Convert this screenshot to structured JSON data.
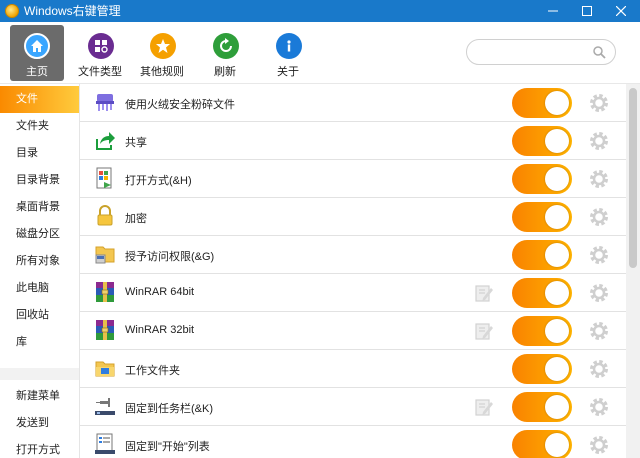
{
  "window": {
    "title": "Windows右键管理"
  },
  "toolbar": {
    "items": [
      {
        "label": "主页",
        "icon": "home-icon",
        "color": "#3aa6ff"
      },
      {
        "label": "文件类型",
        "icon": "file-types-icon",
        "color": "#6a2c91"
      },
      {
        "label": "其他规则",
        "icon": "star-icon",
        "color": "#f5a000"
      },
      {
        "label": "刷新",
        "icon": "refresh-icon",
        "color": "#2e9e3a"
      },
      {
        "label": "关于",
        "icon": "info-icon",
        "color": "#1a7ad8"
      }
    ],
    "search_placeholder": ""
  },
  "sidebar": {
    "items": [
      "文件",
      "文件夹",
      "目录",
      "目录背景",
      "桌面背景",
      "磁盘分区",
      "所有对象",
      "此电脑",
      "回收站",
      "库"
    ],
    "items2": [
      "新建菜单",
      "发送到",
      "打开方式"
    ],
    "active_index": 0
  },
  "rows": [
    {
      "label": "使用火绒安全粉碎文件",
      "icon": "shredder-icon",
      "enabled": true,
      "editable": false
    },
    {
      "label": "共享",
      "icon": "share-icon",
      "enabled": true,
      "editable": false
    },
    {
      "label": "打开方式(&H)",
      "icon": "open-with-icon",
      "enabled": true,
      "editable": false
    },
    {
      "label": "加密",
      "icon": "lock-icon",
      "enabled": true,
      "editable": false
    },
    {
      "label": "授予访问权限(&G)",
      "icon": "grant-access-icon",
      "enabled": true,
      "editable": false
    },
    {
      "label": "WinRAR 64bit",
      "icon": "winrar-icon",
      "enabled": true,
      "editable": true
    },
    {
      "label": "WinRAR 32bit",
      "icon": "winrar-icon",
      "enabled": true,
      "editable": true
    },
    {
      "label": "工作文件夹",
      "icon": "work-folder-icon",
      "enabled": true,
      "editable": false
    },
    {
      "label": "固定到任务栏(&K)",
      "icon": "pin-taskbar-icon",
      "enabled": true,
      "editable": true
    },
    {
      "label": "固定到\"开始\"列表",
      "icon": "pin-start-icon",
      "enabled": true,
      "editable": false
    }
  ],
  "colors": {
    "titlebar": "#1979ca",
    "accent": "#fa8a00",
    "toggle_end": "#ffb300"
  }
}
